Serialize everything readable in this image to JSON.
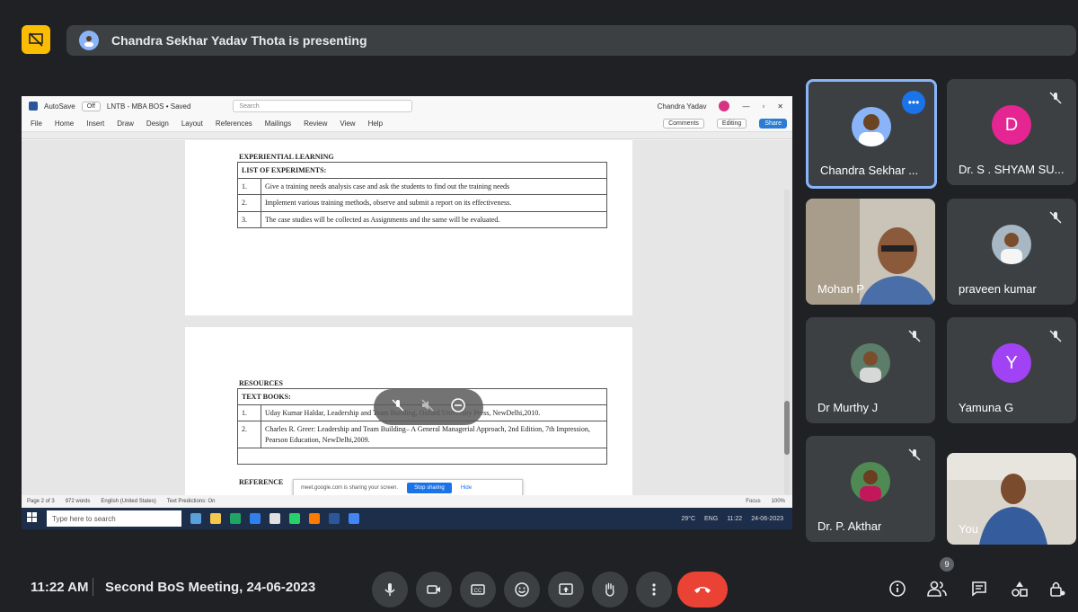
{
  "presenting": {
    "text": "Chandra Sekhar Yadav Thota is presenting"
  },
  "word": {
    "autosave": "AutoSave",
    "toggle": "Off",
    "doc_title": "LNTB - MBA BOS • Saved",
    "search": "Search",
    "user": "Chandra Yadav",
    "menu": [
      "File",
      "Home",
      "Insert",
      "Draw",
      "Design",
      "Layout",
      "References",
      "Mailings",
      "Review",
      "View",
      "Help"
    ],
    "comments": "Comments",
    "editing": "Editing",
    "share": "Share"
  },
  "doc": {
    "heading1": "EXPERIENTIAL LEARNING",
    "experiments_header": "LIST OF EXPERIMENTS:",
    "experiments": [
      {
        "n": "1.",
        "text": "Give a training needs analysis case and ask the students to find out the training needs"
      },
      {
        "n": "2.",
        "text": "Implement various training methods, observe and submit a report on its effectiveness."
      },
      {
        "n": "3.",
        "text": "The case studies will be collected as Assignments and the same will be evaluated."
      }
    ],
    "resources": "RESOURCES",
    "textbooks_header": "TEXT BOOKS:",
    "textbooks": [
      {
        "n": "1.",
        "text": "Uday Kumar Haldar, Leadership and Team Building, Oxford University Press, NewDelhi,2010."
      },
      {
        "n": "2.",
        "text": "Charles R. Greer: Leadership and Team Building– A General Managerial Approach, 2nd Edition, 7th Impression, Pearson Education, NewDelhi,2009."
      }
    ],
    "reference": "REFERENCE"
  },
  "status_bar": {
    "page": "Page 2 of 3",
    "words": "972 words",
    "lang": "English (United States)",
    "predictions": "Text Predictions: On",
    "focus": "Focus",
    "zoom": "100%"
  },
  "share_notice": {
    "text": "meet.google.com is sharing your screen.",
    "stop": "Stop sharing",
    "hide": "Hide"
  },
  "taskbar": {
    "search": "Type here to search",
    "weather": "29°C",
    "lang": "ENG",
    "time": "11:22",
    "date": "24-06-2023"
  },
  "participants": [
    {
      "name": "Chandra Sekhar ...",
      "type": "photo"
    },
    {
      "name": "Dr. S . SHYAM SU...",
      "initial": "D",
      "color": "#e52592"
    },
    {
      "name": "Mohan P",
      "type": "video"
    },
    {
      "name": "praveen kumar",
      "type": "photo"
    },
    {
      "name": "Dr Murthy J",
      "type": "photo"
    },
    {
      "name": "Yamuna G",
      "initial": "Y",
      "color": "#a142f4"
    },
    {
      "name": "Dr. P. Akthar",
      "type": "photo"
    },
    {
      "name": "You",
      "type": "video"
    }
  ],
  "bottom": {
    "time": "11:22 AM",
    "meeting": "Second BoS Meeting, 24-06-2023",
    "people_count": "9"
  },
  "colors": {
    "accent": "#8ab4f8",
    "end_call": "#ea4335",
    "present_badge": "#fbbc04"
  }
}
